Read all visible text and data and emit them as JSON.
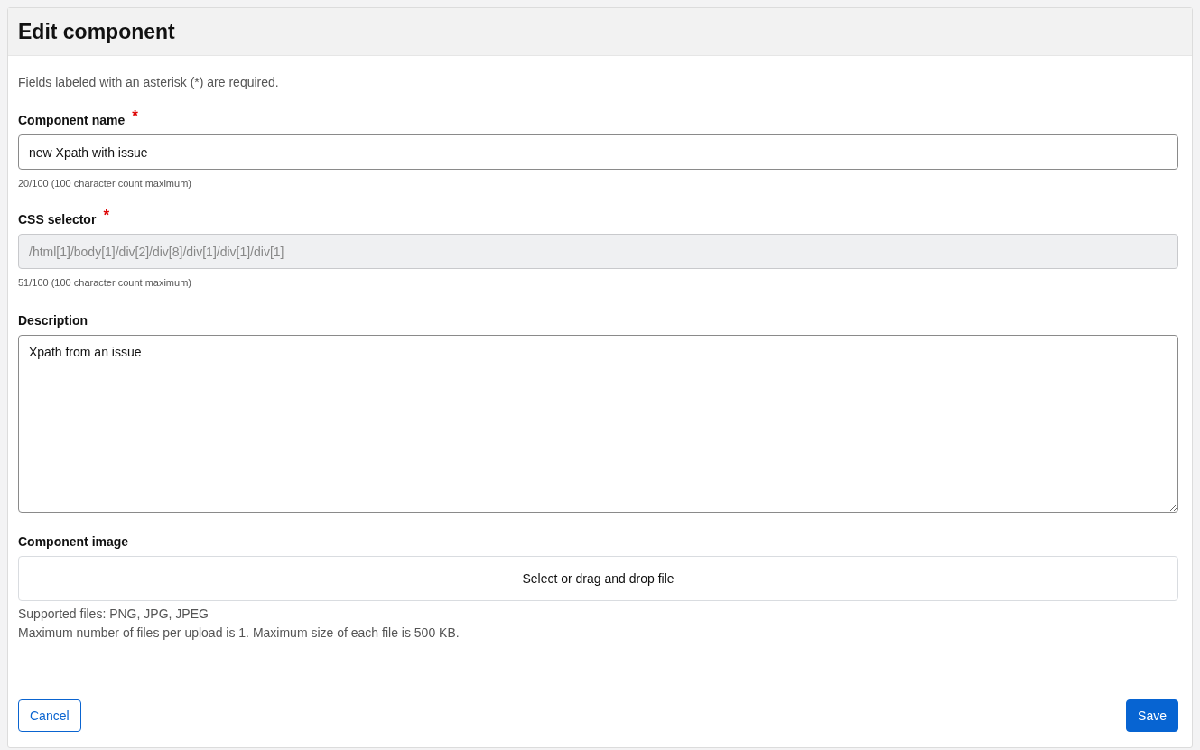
{
  "dialog": {
    "title": "Edit component"
  },
  "required_note": "Fields labeled with an asterisk (*) are required.",
  "required_marker": "*",
  "fields": [
    {
      "kind": "text",
      "label": "Component name",
      "required": true,
      "value": "new Xpath with issue",
      "disabled": false,
      "counter": "20/100 (100 character count maximum)"
    },
    {
      "kind": "text",
      "label": "CSS selector",
      "required": true,
      "value": "/html[1]/body[1]/div[2]/div[8]/div[1]/div[1]/div[1]",
      "disabled": true,
      "counter": "51/100 (100 character count maximum)"
    },
    {
      "kind": "textarea",
      "label": "Description",
      "required": false,
      "value": "Xpath from an issue",
      "disabled": false
    },
    {
      "kind": "file",
      "label": "Component image",
      "required": false,
      "prompt": "Select or drag and drop file",
      "notes": [
        "Supported files: PNG, JPG, JPEG",
        "Maximum number of files per upload is 1. Maximum size of each file is 500 KB."
      ]
    }
  ],
  "buttons": [
    {
      "kind": "secondary",
      "label": "Cancel"
    },
    {
      "kind": "primary",
      "label": "Save"
    }
  ]
}
